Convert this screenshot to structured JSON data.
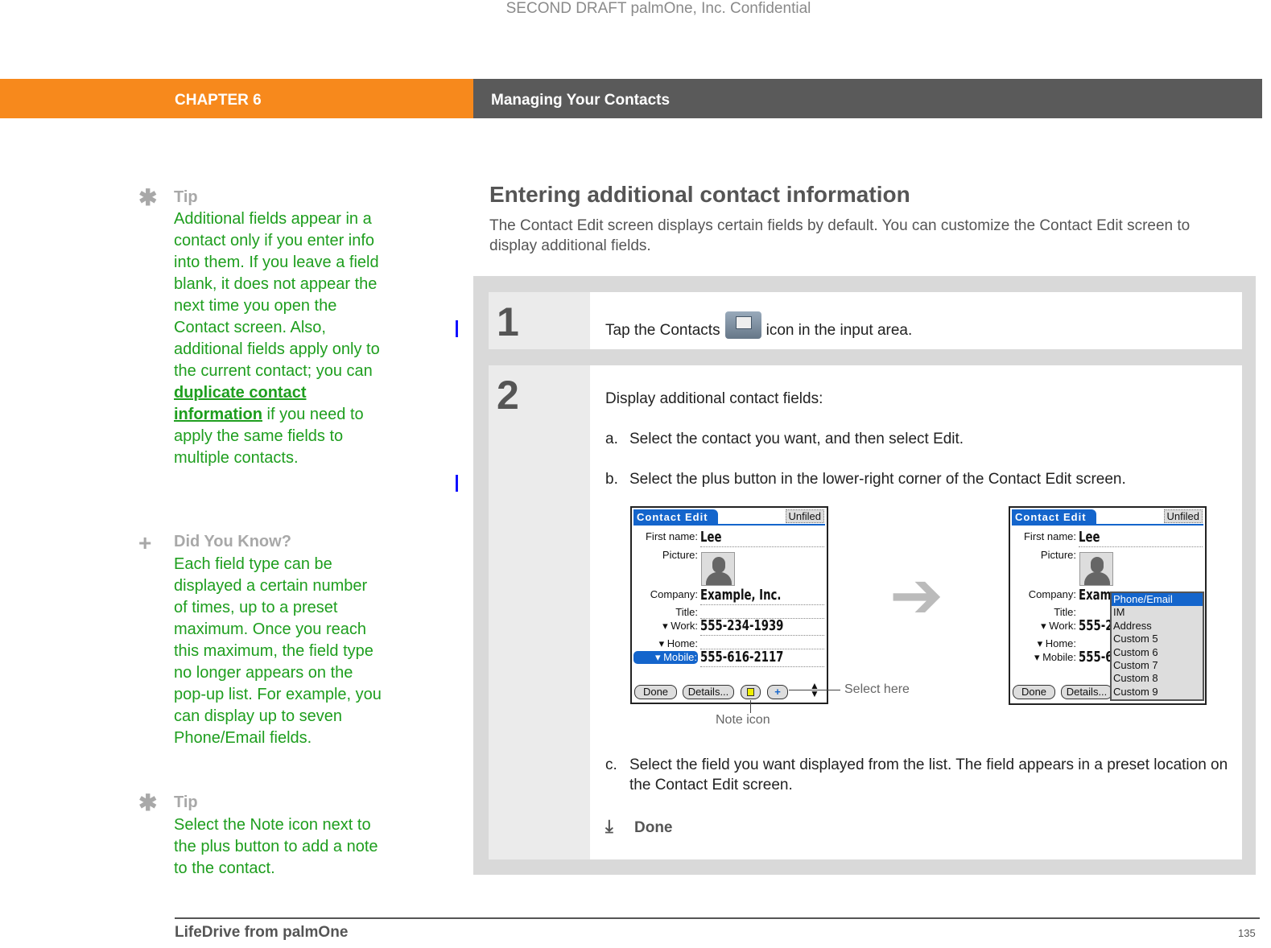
{
  "watermark": "SECOND DRAFT palmOne, Inc.  Confidential",
  "header": {
    "chapter": "CHAPTER 6",
    "title": "Managing Your Contacts"
  },
  "sidebar": [
    {
      "icon": "asterisk-icon",
      "title": "Tip",
      "text_before": "Additional fields appear in a contact only if you enter info into them. If you leave a field blank, it does not appear the next time you open the Contact screen. Also, additional fields apply only to the current contact; you can ",
      "link": "duplicate contact information",
      "text_after": " if you need to apply the same fields to multiple contacts."
    },
    {
      "icon": "plus-icon",
      "title": "Did You Know?",
      "text": "Each field type can be displayed a certain number of times, up to a preset maximum. Once you reach this maximum, the field type no longer appears on the pop-up list. For example, you can display up to seven Phone/Email fields."
    },
    {
      "icon": "asterisk-icon",
      "title": "Tip",
      "text": "Select the Note icon next to the plus button to add a note to the contact."
    }
  ],
  "main": {
    "heading": "Entering additional contact information",
    "intro": "The Contact Edit screen displays certain fields by default. You can customize the Contact Edit screen to display additional fields.",
    "steps": [
      {
        "number": "1",
        "text_before": "Tap the Contacts",
        "icon": "contacts-icon",
        "text_after": "icon in the input area."
      },
      {
        "number": "2",
        "text": "Display additional contact fields:",
        "substeps": [
          {
            "label": "a.",
            "text": "Select the contact you want, and then select Edit."
          },
          {
            "label": "b.",
            "text": "Select the plus button in the lower-right corner of the Contact Edit screen."
          },
          {
            "label": "c.",
            "text": "Select the field you want displayed from the list. The field appears in a preset location on the Contact Edit screen."
          }
        ],
        "done": "Done"
      }
    ],
    "screen": {
      "title": "Contact Edit",
      "category": "Unfiled",
      "labels": {
        "first_name": "First name:",
        "picture": "Picture:",
        "company": "Company:",
        "title": "Title:",
        "work": "Work:",
        "home": "Home:",
        "mobile": "Mobile:"
      },
      "values": {
        "first_name": "Lee",
        "company": "Example, Inc.",
        "work": "555-234-1939",
        "mobile": "555-616-2117"
      },
      "values_truncated": {
        "company": "Exam",
        "work": "555-2",
        "mobile": "555-6"
      },
      "buttons": {
        "done": "Done",
        "details": "Details..."
      },
      "popup": [
        "Phone/Email",
        "IM",
        "Address",
        "Custom 5",
        "Custom 6",
        "Custom 7",
        "Custom 8",
        "Custom 9"
      ],
      "popup_selected": "Phone/Email"
    },
    "callouts": {
      "select_here": "Select here",
      "note_icon": "Note icon"
    }
  },
  "footer": {
    "title": "LifeDrive from palmOne",
    "page": "135"
  },
  "colors": {
    "orange": "#f7891c",
    "header_gray": "#5a5a5a",
    "tip_green": "#1e9e1e",
    "palm_blue": "#1465cc"
  }
}
